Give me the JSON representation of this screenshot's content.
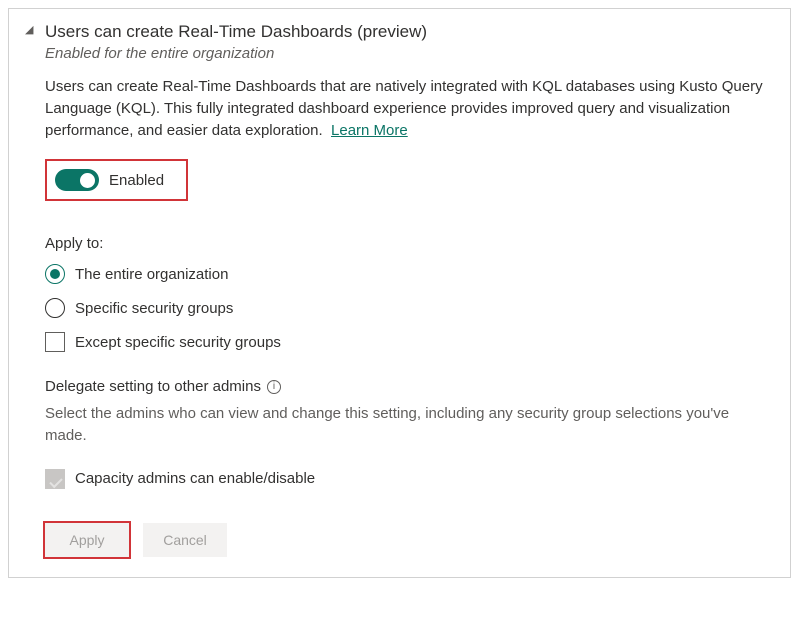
{
  "header": {
    "title": "Users can create Real-Time Dashboards (preview)",
    "subtitle": "Enabled for the entire organization"
  },
  "description": "Users can create Real-Time Dashboards that are natively integrated with KQL databases using Kusto Query Language (KQL). This fully integrated dashboard experience provides improved query and visualization performance, and easier data exploration.",
  "learn_more": "Learn More",
  "toggle": {
    "label": "Enabled",
    "state": true
  },
  "apply_to": {
    "label": "Apply to:",
    "options": {
      "entire_org": "The entire organization",
      "specific_groups": "Specific security groups"
    },
    "except_label": "Except specific security groups"
  },
  "delegate": {
    "title": "Delegate setting to other admins",
    "description": "Select the admins who can view and change this setting, including any security group selections you've made.",
    "capacity_label": "Capacity admins can enable/disable"
  },
  "buttons": {
    "apply": "Apply",
    "cancel": "Cancel"
  }
}
